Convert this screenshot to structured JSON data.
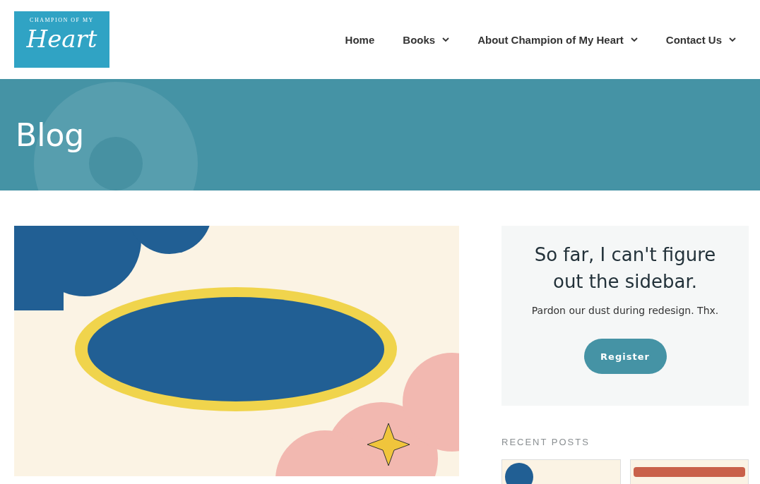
{
  "logo": {
    "top": "CHAMPION OF MY",
    "script": "Heart"
  },
  "nav": [
    {
      "label": "Home",
      "dropdown": false
    },
    {
      "label": "Books",
      "dropdown": true
    },
    {
      "label": "About Champion of My Heart",
      "dropdown": true
    },
    {
      "label": "Contact Us",
      "dropdown": true
    }
  ],
  "banner": {
    "title": "Blog"
  },
  "sidebar": {
    "heading": "So far, I can't figure out the sidebar.",
    "text": "Pardon our dust during redesign. Thx.",
    "button": "Register",
    "recent_label": "RECENT POSTS"
  }
}
